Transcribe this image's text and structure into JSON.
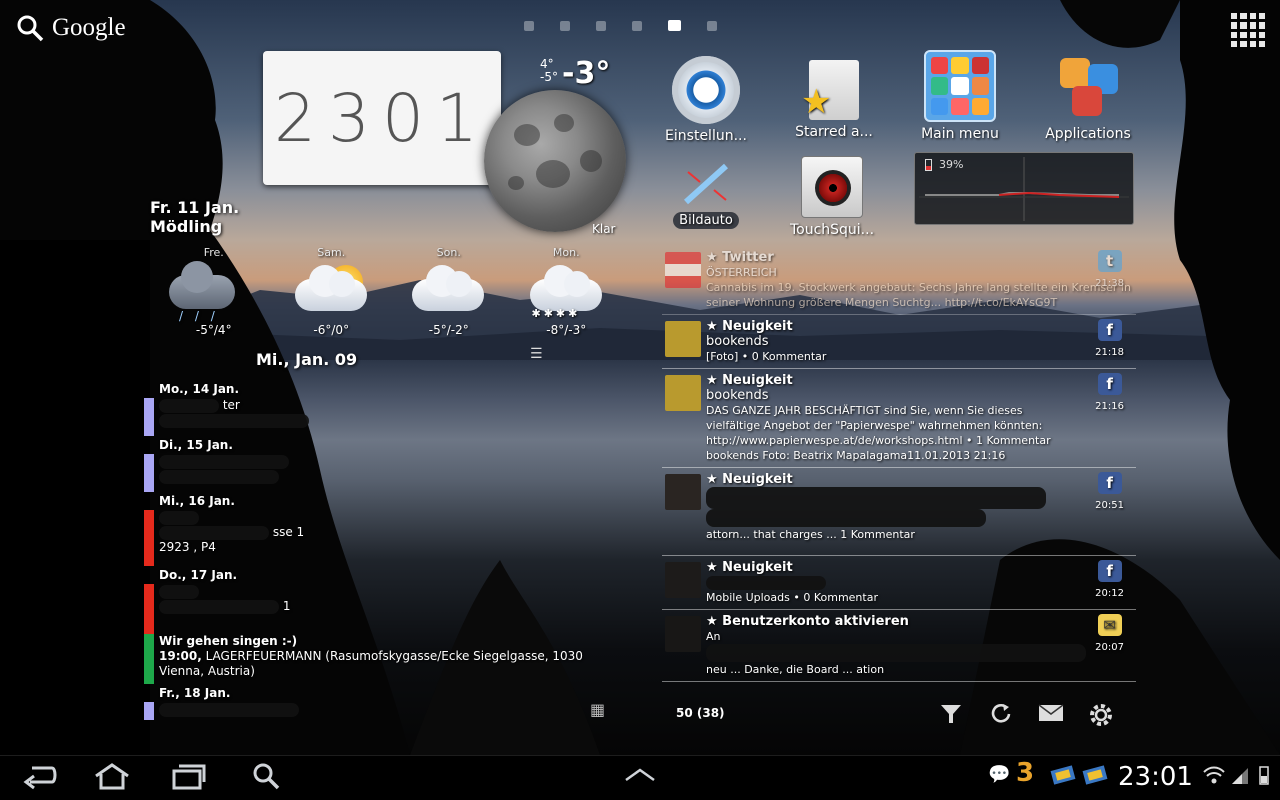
{
  "search": {
    "label": "Google"
  },
  "clock": {
    "time": "23:01",
    "digits": "2301"
  },
  "weather": {
    "temp_high_low": "4°",
    "temp_low": "-5°",
    "temp_now": "-3°",
    "moon_caption": "Klar",
    "date_line": "Fr. 11 Jan.",
    "location": "Mödling",
    "forecast": [
      {
        "day": "Fre.",
        "temp": "-5°/4°",
        "icon": "rain-cloud-icon"
      },
      {
        "day": "Sam.",
        "temp": "-6°/0°",
        "icon": "sun-cloud-icon"
      },
      {
        "day": "Son.",
        "temp": "-5°/-2°",
        "icon": "cloud-icon"
      },
      {
        "day": "Mon.",
        "temp": "-8°/-3°",
        "icon": "snow-cloud-icon"
      }
    ]
  },
  "calendar": {
    "today_label": "Mi., Jan. 09",
    "days": [
      {
        "day": "Mo., 14 Jan.",
        "event_line1": "ter",
        "event_line2": "",
        "color": "#a9a6f4"
      },
      {
        "day": "Di., 15 Jan.",
        "event_line1": "",
        "event_line2": "",
        "color": "#a9a6f4"
      },
      {
        "day": "Mi., 16 Jan.",
        "event_line1": "sse 1",
        "event_line2": "2923 , P4",
        "color": "#e52a1c"
      },
      {
        "day": "Do., 17 Jan.",
        "event_line1": "1",
        "event_line2": "",
        "color": "#e52a1c"
      }
    ],
    "highlight_event": {
      "title": "Wir gehen singen :-)",
      "time": "19:00,",
      "details": "LAGERFEUERMANN (Rasumofskygasse/Ecke Siegelgasse, 1030 Vienna, Austria)",
      "color": "#1ea84a"
    },
    "last_day": "Fr., 18 Jan."
  },
  "apps": {
    "settings": "Einstellun...",
    "starred": "Starred a...",
    "main_menu": "Main menu",
    "applications": "Applications",
    "bildauto": "Bildauto",
    "touchsquid": "TouchSqui..."
  },
  "battery": {
    "percent_label": "39%",
    "level": 0.39
  },
  "feed": {
    "items": [
      {
        "title": "★ Twitter",
        "sub": "ÖSTERREICH",
        "body": "Cannabis im 19. Stockwerk angebaut: Sechs Jahre lang stellte ein Kremser in seiner Wohnung größere Mengen Suchtg... http://t.co/EkAYsG9T",
        "meta": "",
        "time": "21:38",
        "source": "twitter-icon",
        "avatar": "austria-flag-avatar"
      },
      {
        "title": "★ Neuigkeit",
        "sub": "bookends",
        "body": "",
        "meta": "[Foto] • 0 Kommentar",
        "time": "21:18",
        "source": "facebook-icon",
        "avatar": "bookends-avatar"
      },
      {
        "title": "★ Neuigkeit",
        "sub": "bookends",
        "body": "DAS GANZE JAHR BESCHÄFTIGT sind Sie, wenn Sie dieses vielfältige Angebot der \"Papierwespe\" wahrnehmen könnten: http://www.papierwespe.at/de/workshops.html • 1 Kommentar bookends Foto: Beatrix Mapalagama11.01.2013 21:16",
        "meta": "",
        "time": "21:16",
        "source": "facebook-icon",
        "avatar": "bookends-avatar"
      },
      {
        "title": "★ Neuigkeit",
        "sub": "",
        "body": "attorn... that charges ... 1 Kommentar",
        "meta": "",
        "time": "20:51",
        "source": "facebook-icon",
        "avatar": "person-avatar"
      },
      {
        "title": "★ Neuigkeit",
        "sub": "",
        "body": "",
        "meta": "Mobile Uploads • 0 Kommentar",
        "time": "20:12",
        "source": "facebook-icon",
        "avatar": "person-avatar"
      },
      {
        "title": "★ Benutzerkonto aktivieren",
        "sub": "An",
        "body": "neu ... Danke, die Board ... ation",
        "meta": "",
        "time": "20:07",
        "source": "mail-icon",
        "avatar": "person-avatar"
      }
    ],
    "count": "50 (38)"
  },
  "statusbar": {
    "time": "23:01",
    "carrier": "3"
  },
  "colors": {
    "accent_blue": "#33b5e5",
    "facebook": "#3b5998"
  }
}
